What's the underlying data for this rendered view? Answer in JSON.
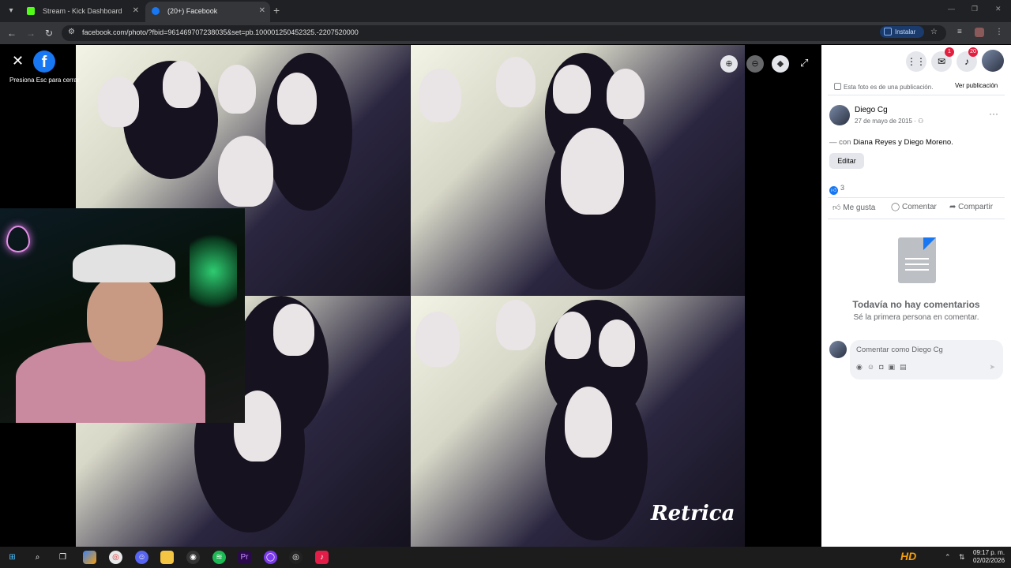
{
  "browser": {
    "tabs": [
      {
        "title": "Stream - Kick Dashboard",
        "favicon_color": "#53fc18"
      },
      {
        "title": "(20+) Facebook",
        "favicon_color": "#1877f2"
      }
    ],
    "new_tab_icon": "+",
    "url": "facebook.com/photo/?fbid=961469707238035&set=pb.100001250452325.-2207520000",
    "install_label": "Instalar"
  },
  "viewer": {
    "close_tip": "Presiona Esc para cerrar",
    "watermark": "Retrica",
    "buttons": [
      "zoom-in-icon",
      "zoom-out-icon",
      "tag-icon",
      "fullscreen-icon"
    ]
  },
  "header": {
    "messenger_badge": "1",
    "notifications_badge": "20"
  },
  "post": {
    "info_text": "Esta foto es de una publicación.",
    "view_post_label": "Ver publicación",
    "author": "Diego Cg",
    "date": "27 de mayo de 2015",
    "with_prefix": "— con",
    "with_names": "Diana Reyes y Diego Moreno.",
    "edit_label": "Editar",
    "like_count": "3",
    "actions": {
      "like": "Me gusta",
      "comment": "Comentar",
      "share": "Compartir"
    }
  },
  "comments": {
    "empty_title": "Todavía no hay comentarios",
    "empty_subtitle": "Sé la primera persona en comentar.",
    "input_placeholder": "Comentar como Diego Cg"
  },
  "taskbar": {
    "clock_time": "09:17 p. m.",
    "clock_date": "02/02/2026"
  },
  "colors": {
    "facebook_blue": "#1877f2",
    "badge_red": "#e41e3f",
    "kick_green": "#53fc18"
  }
}
